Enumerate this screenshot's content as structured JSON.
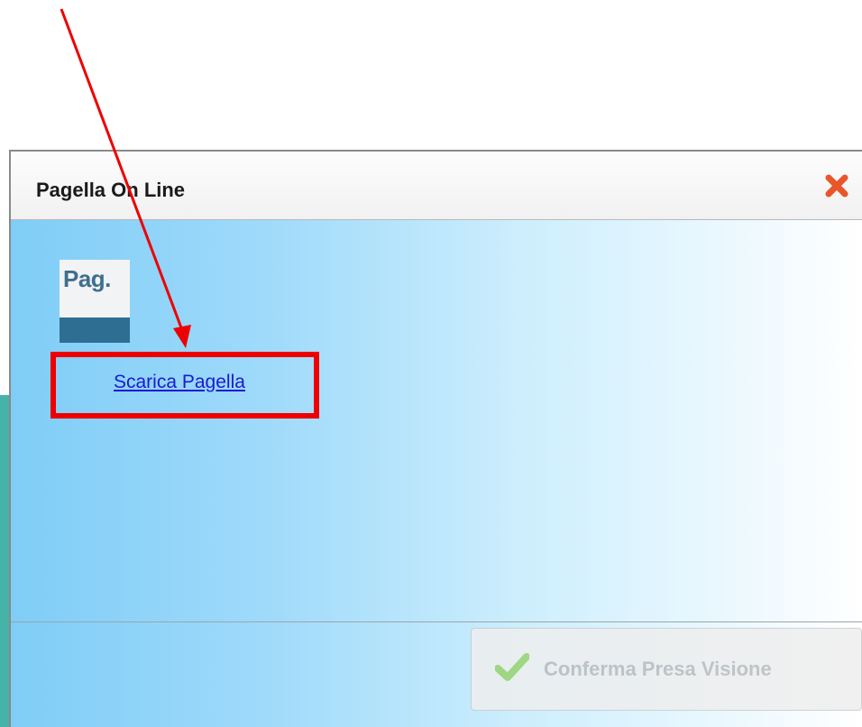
{
  "dialog": {
    "title": "Pagella On Line",
    "close_icon": "close-x-icon",
    "document_icon_text": "Pag.",
    "download_link": "Scarica Pagella",
    "confirm_button": "Conferma Presa Visione"
  },
  "colors": {
    "annotation": "#ee0000",
    "close_icon": "#e8572a",
    "link": "#1a1ad2",
    "check_icon": "#7ac943",
    "icon_bar": "#2f6e93"
  },
  "annotation": {
    "type": "red-arrow-and-highlight-box"
  }
}
